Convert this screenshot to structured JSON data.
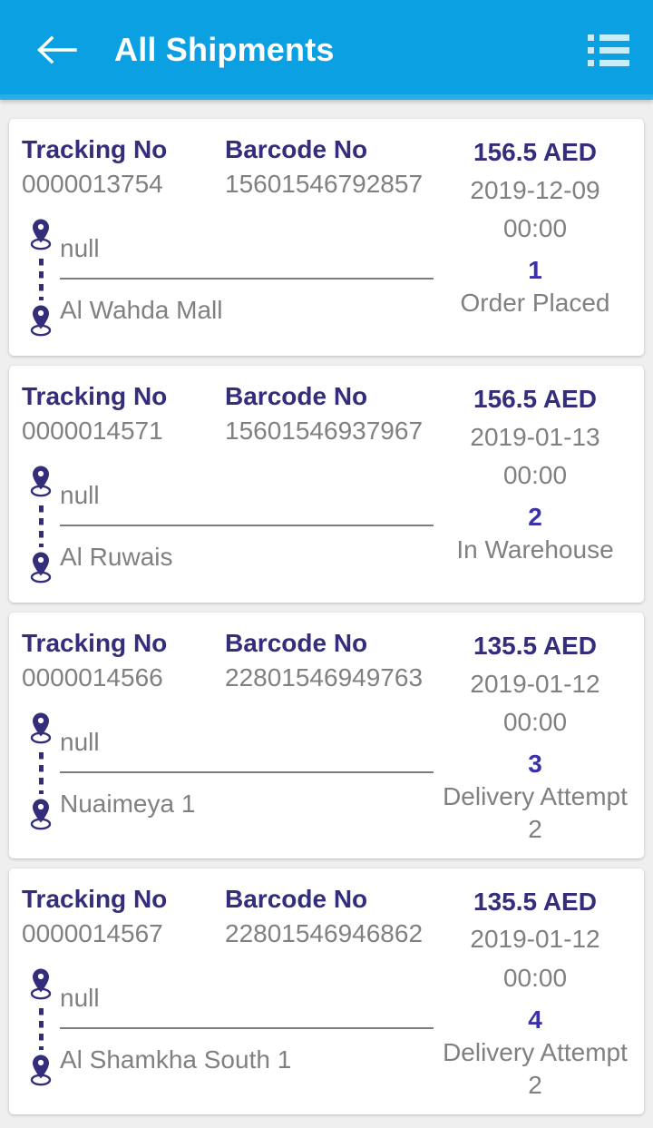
{
  "appbar": {
    "title": "All Shipments",
    "back_icon": "back-arrow-icon",
    "menu_icon": "list-view-icon",
    "background_color": "#0ba0e2",
    "title_color": "#ffffff"
  },
  "theme": {
    "accent_blue": "#0ba0e2",
    "label_purple": "#332d7c",
    "status_purple": "#3b32a8",
    "value_gray": "#808080",
    "page_background": "#efeff0",
    "card_background": "#ffffff"
  },
  "labels": {
    "tracking_no": "Tracking No",
    "barcode_no": "Barcode No"
  },
  "shipments": [
    {
      "tracking_no": "0000013754",
      "barcode_no": "15601546792857",
      "origin": "null",
      "destination": "Al Wahda Mall",
      "amount": "156.5 AED",
      "date": "2019-12-09",
      "time": "00:00",
      "status_code": "1",
      "status_text": "Order Placed"
    },
    {
      "tracking_no": "0000014571",
      "barcode_no": "15601546937967",
      "origin": "null",
      "destination": "Al Ruwais",
      "amount": "156.5 AED",
      "date": "2019-01-13",
      "time": "00:00",
      "status_code": "2",
      "status_text": "In Warehouse"
    },
    {
      "tracking_no": "0000014566",
      "barcode_no": "22801546949763",
      "origin": "null",
      "destination": "Nuaimeya 1",
      "amount": "135.5 AED",
      "date": "2019-01-12",
      "time": "00:00",
      "status_code": "3",
      "status_text": "Delivery Attempt 2"
    },
    {
      "tracking_no": "0000014567",
      "barcode_no": "22801546946862",
      "origin": "null",
      "destination": "Al Shamkha South 1",
      "amount": "135.5 AED",
      "date": "2019-01-12",
      "time": "00:00",
      "status_code": "4",
      "status_text": "Delivery Attempt 2"
    }
  ]
}
